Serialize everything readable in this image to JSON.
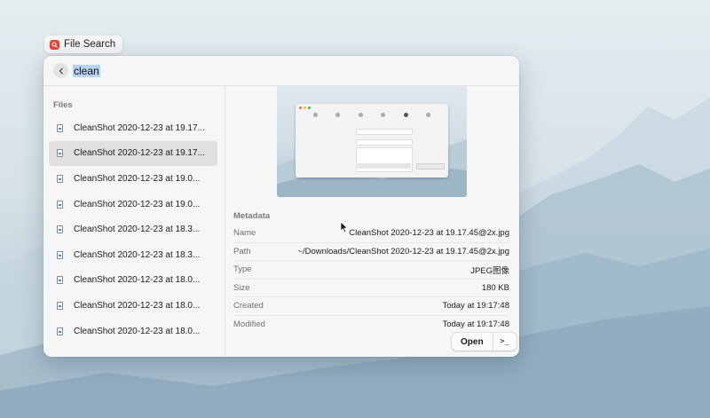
{
  "app": {
    "title": "File Search",
    "icon": "file-search-app-icon"
  },
  "search": {
    "query": "clean"
  },
  "sidebar": {
    "title": "Files",
    "items": [
      {
        "label": "CleanShot 2020-12-23 at 19.17...",
        "selected": false
      },
      {
        "label": "CleanShot 2020-12-23 at 19.17...",
        "selected": true
      },
      {
        "label": "CleanShot 2020-12-23 at 19.0...",
        "selected": false
      },
      {
        "label": "CleanShot 2020-12-23 at 19.0...",
        "selected": false
      },
      {
        "label": "CleanShot 2020-12-23 at 18.3...",
        "selected": false
      },
      {
        "label": "CleanShot 2020-12-23 at 18.3...",
        "selected": false
      },
      {
        "label": "CleanShot 2020-12-23 at 18.0...",
        "selected": false
      },
      {
        "label": "CleanShot 2020-12-23 at 18.0...",
        "selected": false
      },
      {
        "label": "CleanShot 2020-12-23 at 18.0...",
        "selected": false
      }
    ]
  },
  "metadata": {
    "title": "Metadata",
    "rows": [
      {
        "key": "Name",
        "value": "CleanShot 2020-12-23 at 19.17.45@2x.jpg"
      },
      {
        "key": "Path",
        "value": "~/Downloads/CleanShot 2020-12-23 at 19.17.45@2x.jpg"
      },
      {
        "key": "Type",
        "value": "JPEG图像"
      },
      {
        "key": "Size",
        "value": "180 KB"
      },
      {
        "key": "Created",
        "value": "Today at 19:17:48"
      },
      {
        "key": "Modified",
        "value": "Today at 19:17:48"
      }
    ]
  },
  "actions": {
    "open_label": "Open",
    "terminal_label": ">_"
  },
  "colors": {
    "accent_selection": "#b6d3f4",
    "selected_row": "#e0e0e0",
    "app_icon": "#e0463a"
  }
}
